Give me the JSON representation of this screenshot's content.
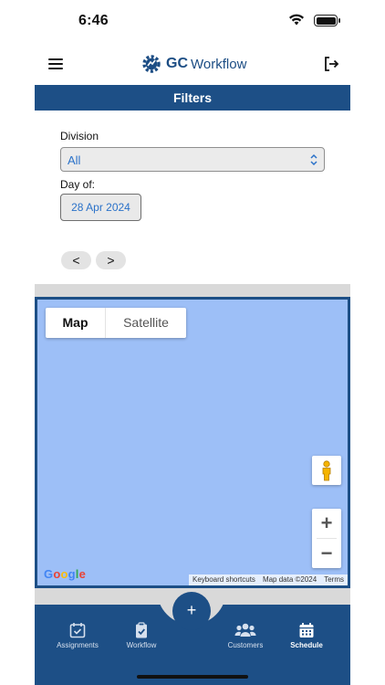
{
  "status": {
    "time": "6:46"
  },
  "header": {
    "brand_gc": "GC",
    "brand_workflow": "Workflow"
  },
  "filters": {
    "title": "Filters",
    "division_label": "Division",
    "division_value": "All",
    "day_label": "Day of:",
    "date_value": "28 Apr 2024",
    "prev_label": "<",
    "next_label": ">"
  },
  "map": {
    "tab_map": "Map",
    "tab_satellite": "Satellite",
    "zoom_in": "+",
    "zoom_out": "−",
    "google": "Google",
    "attribution": [
      "Keyboard shortcuts",
      "Map data ©2024",
      "Terms"
    ]
  },
  "nav": {
    "fab": "+",
    "tabs": [
      "Assignments",
      "Workflow",
      "Customers",
      "Schedule"
    ],
    "active": "Schedule"
  },
  "colors": {
    "brand": "#1d4f86",
    "map_bg": "#9dbff7",
    "link": "#2b72c9"
  }
}
